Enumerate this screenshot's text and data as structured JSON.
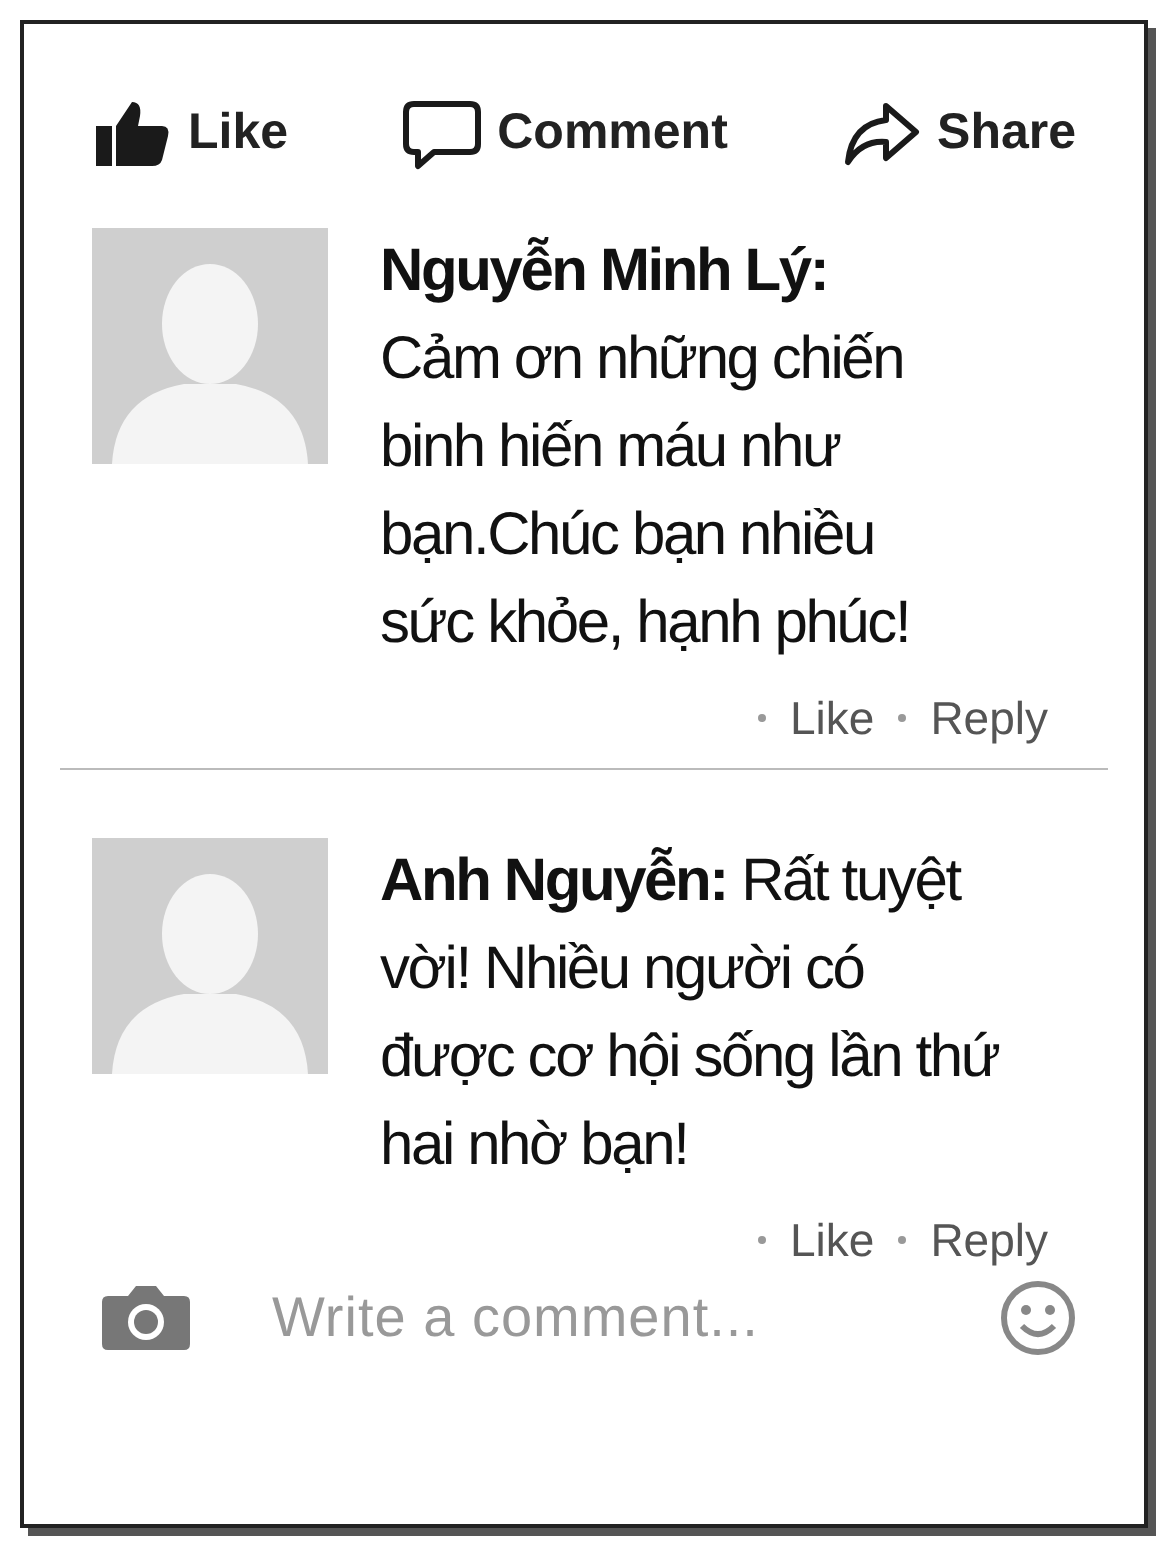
{
  "actions": [
    {
      "kind": "like",
      "label": "Like"
    },
    {
      "kind": "comment",
      "label": "Comment"
    },
    {
      "kind": "share",
      "label": "Share"
    }
  ],
  "comments": [
    {
      "kind": "stacked",
      "author": "Nguyễn Minh Lý:",
      "text": "Cảm ơn những chiến binh hiến máu như bạn.Chúc bạn nhiều sức khỏe, hạnh phúc!",
      "like": "Like",
      "reply": "Reply"
    },
    {
      "kind": "inline",
      "text": "**Anh Nguyễn:** Rất tuyệt vời! Nhiều người có được cơ hội sống lần thứ hai nhờ bạn!",
      "like": "Like",
      "reply": "Reply"
    }
  ],
  "composer": {
    "placeholder": "Write a comment..."
  }
}
